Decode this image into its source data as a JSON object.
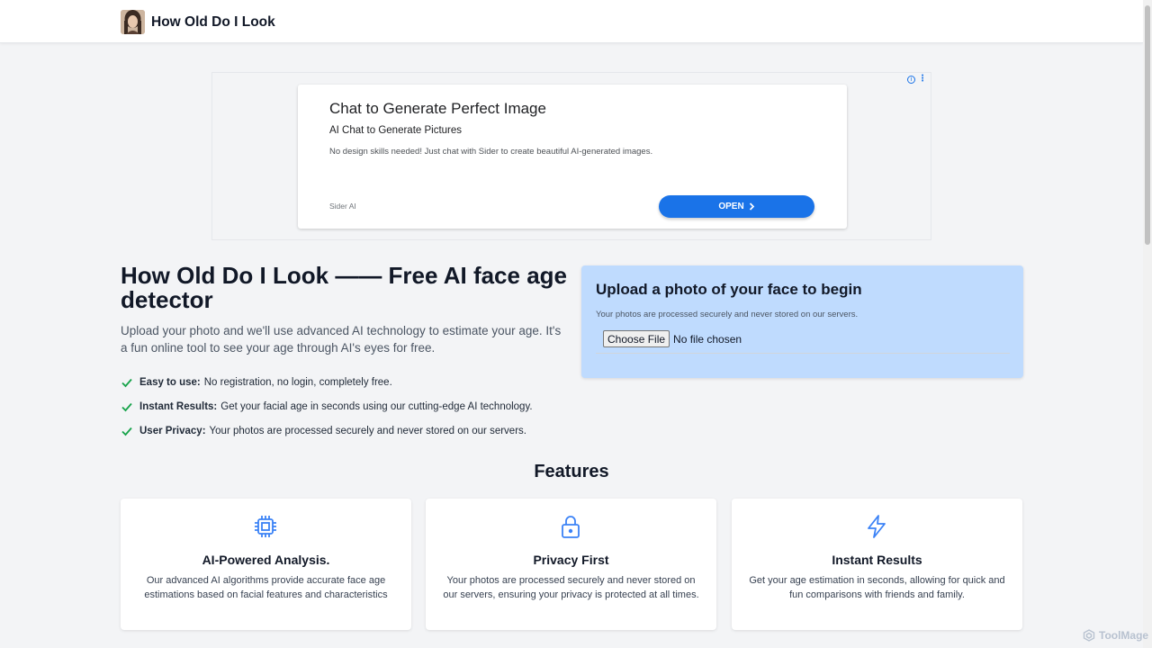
{
  "header": {
    "title": "How Old Do I Look"
  },
  "ad": {
    "title": "Chat to Generate Perfect Image",
    "subtitle": "AI Chat to Generate Pictures",
    "description": "No design skills needed! Just chat with Sider to create beautiful AI-generated images.",
    "advertiser": "Sider AI",
    "button_label": "OPEN",
    "info_glyph": "i",
    "menu_glyph": "⋮"
  },
  "hero": {
    "title": "How Old Do I Look —— Free AI face age detector",
    "description": "Upload your photo and we'll use advanced AI technology to estimate your age. It's a fun online tool to see your age through AI's eyes for free.",
    "bullets": [
      {
        "label": "Easy to use:",
        "text": "No registration, no login, completely free."
      },
      {
        "label": "Instant Results:",
        "text": "Get your facial age in seconds using our cutting-edge AI technology."
      },
      {
        "label": "User Privacy:",
        "text": "Your photos are processed securely and never stored on our servers."
      }
    ]
  },
  "upload": {
    "title": "Upload a photo of your face to begin",
    "note": "Your photos are processed securely and never stored on our servers.",
    "button_label": "Choose File",
    "file_status": "No file chosen"
  },
  "features": {
    "title": "Features",
    "items": [
      {
        "icon": "cpu-icon",
        "title": "AI-Powered Analysis.",
        "description": "Our advanced AI algorithms provide accurate face age estimations based on facial features and characteristics"
      },
      {
        "icon": "lock-icon",
        "title": "Privacy First",
        "description": "Your photos are processed securely and never stored on our servers, ensuring your privacy is protected at all times."
      },
      {
        "icon": "lightning-icon",
        "title": "Instant Results",
        "description": "Get your age estimation in seconds, allowing for quick and fun comparisons with friends and family."
      }
    ]
  },
  "watermark": {
    "text": "ToolMage"
  },
  "colors": {
    "accent_blue": "#1a73e8",
    "check_green": "#16a34a",
    "upload_bg": "#bfdbfe",
    "icon_blue": "#3b82f6"
  }
}
